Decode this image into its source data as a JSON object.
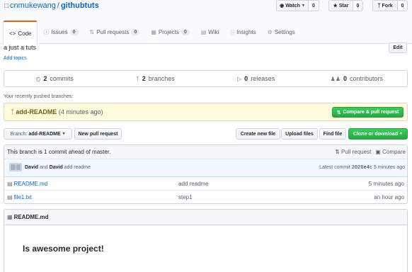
{
  "repo": {
    "owner": "cnmukewang",
    "separator": "/",
    "name": "githubtuts"
  },
  "actions": {
    "watch": {
      "label": "Watch",
      "count": "0"
    },
    "star": {
      "label": "Star",
      "count": "0"
    },
    "fork": {
      "label": "Fork",
      "count": "0"
    }
  },
  "tabs": [
    {
      "label": "Code",
      "icon": "code-icon"
    },
    {
      "label": "Issues",
      "count": "0",
      "icon": "issue-icon"
    },
    {
      "label": "Pull requests",
      "count": "0",
      "icon": "pull-request-icon"
    },
    {
      "label": "Projects",
      "count": "0",
      "icon": "project-icon"
    },
    {
      "label": "Wiki",
      "icon": "book-icon"
    },
    {
      "label": "Insights",
      "icon": "graph-icon"
    },
    {
      "label": "Settings",
      "icon": "gear-icon"
    }
  ],
  "description": "a just a tuts",
  "add_topics": "Add topics",
  "edit_label": "Edit",
  "summary": {
    "commits": {
      "count": "2",
      "label": "commits"
    },
    "branches": {
      "count": "2",
      "label": "branches"
    },
    "releases": {
      "count": "0",
      "label": "releases"
    },
    "contributors": {
      "count": "0",
      "label": "contributors"
    }
  },
  "recent_label": "Your recently pushed branches:",
  "recent_branch": {
    "name": "add-README",
    "time": "(4 minutes ago)"
  },
  "compare_pr_label": "Compare & pull request",
  "branch_select": {
    "prefix": "Branch:",
    "value": "add-README"
  },
  "toolbar": {
    "new_pr": "New pull request",
    "create_file": "Create new file",
    "upload": "Upload files",
    "find": "Find file",
    "clone": "Clone or download"
  },
  "ahead": {
    "text": "This branch is 1 commit ahead of master.",
    "pull_request": "Pull request",
    "compare": "Compare"
  },
  "latest_commit": {
    "author1": "David",
    "and_word": "and",
    "author2": "David",
    "message": "add readme",
    "prefix": "Latest commit",
    "sha": "2026e4c",
    "age": "5 minutes ago"
  },
  "files": [
    {
      "name": "README.md",
      "message": "add readme",
      "age": "5 minutes ago"
    },
    {
      "name": "file1.txt",
      "message": "step1",
      "age": "an hour ago"
    }
  ],
  "readme": {
    "title": "README.md",
    "heading": "Is awesome project!"
  },
  "colors": {
    "link": "#0366d6",
    "accent_tab": "#e36209",
    "green_button": "#28a745",
    "banner_bg": "#fffbdd",
    "commit_bar_bg": "#f1f8ff"
  }
}
